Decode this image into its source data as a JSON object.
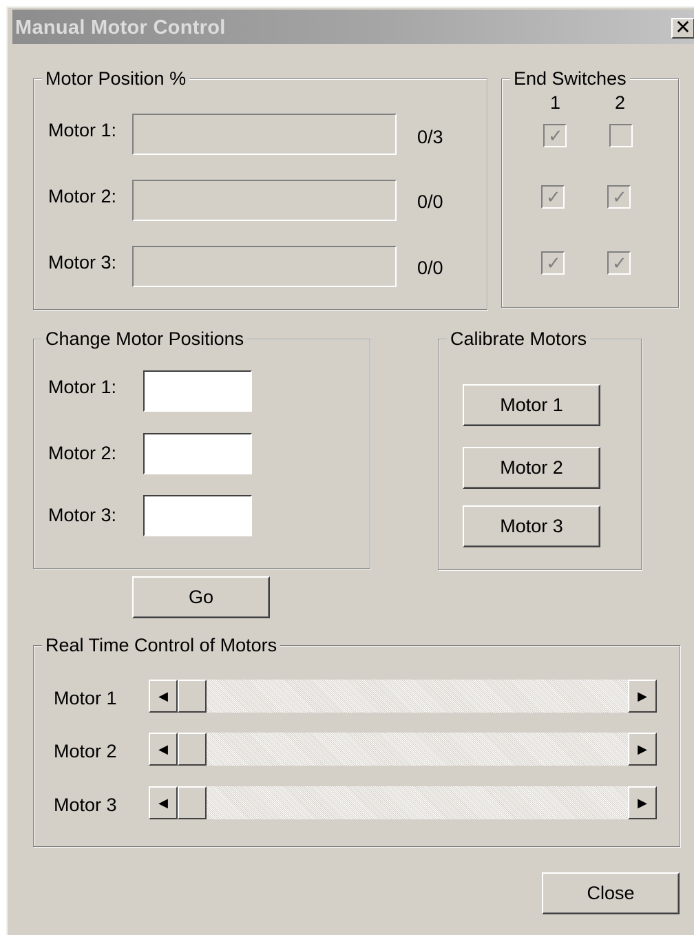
{
  "window": {
    "title": "Manual Motor Control",
    "close_glyph": "✕"
  },
  "motor_position": {
    "legend": "Motor Position %",
    "rows": [
      {
        "label": "Motor 1:",
        "value": "0/3"
      },
      {
        "label": "Motor 2:",
        "value": "0/0"
      },
      {
        "label": "Motor 3:",
        "value": "0/0"
      }
    ]
  },
  "end_switches": {
    "legend": "End Switches",
    "col_headers": [
      "1",
      "2"
    ],
    "rows": [
      {
        "s1": true,
        "s2": false
      },
      {
        "s1": true,
        "s2": true
      },
      {
        "s1": true,
        "s2": true
      }
    ]
  },
  "change_positions": {
    "legend": "Change Motor Positions",
    "labels": [
      "Motor 1:",
      "Motor 2:",
      "Motor 3:"
    ],
    "values": [
      "",
      "",
      ""
    ]
  },
  "calibrate": {
    "legend": "Calibrate Motors",
    "buttons": [
      "Motor 1",
      "Motor 2",
      "Motor 3"
    ]
  },
  "go_button": "Go",
  "realtime": {
    "legend": "Real Time Control of Motors",
    "labels": [
      "Motor 1",
      "Motor 2",
      "Motor 3"
    ],
    "slider_values": [
      0,
      0,
      0
    ]
  },
  "close_button": "Close",
  "icons": {
    "check": "check-icon",
    "arrow_left": "left-arrow-icon",
    "arrow_right": "right-arrow-icon"
  }
}
